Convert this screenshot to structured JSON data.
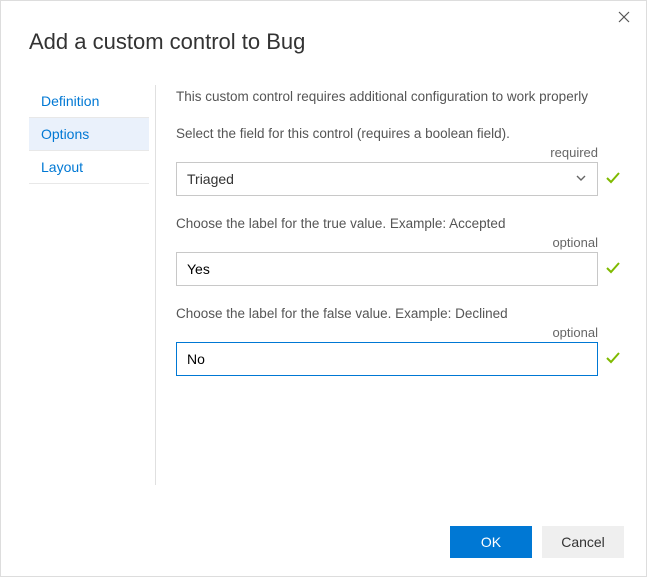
{
  "dialog": {
    "title": "Add a custom control to Bug"
  },
  "sidebar": {
    "tabs": [
      {
        "label": "Definition"
      },
      {
        "label": "Options"
      },
      {
        "label": "Layout"
      }
    ]
  },
  "main": {
    "intro": "This custom control requires additional configuration to work properly",
    "field1": {
      "label": "Select the field for this control (requires a boolean field).",
      "tag": "required",
      "value": "Triaged"
    },
    "field2": {
      "label": "Choose the label for the true value. Example: Accepted",
      "tag": "optional",
      "value": "Yes"
    },
    "field3": {
      "label": "Choose the label for the false value. Example: Declined",
      "tag": "optional",
      "value": "No"
    }
  },
  "footer": {
    "ok": "OK",
    "cancel": "Cancel"
  }
}
